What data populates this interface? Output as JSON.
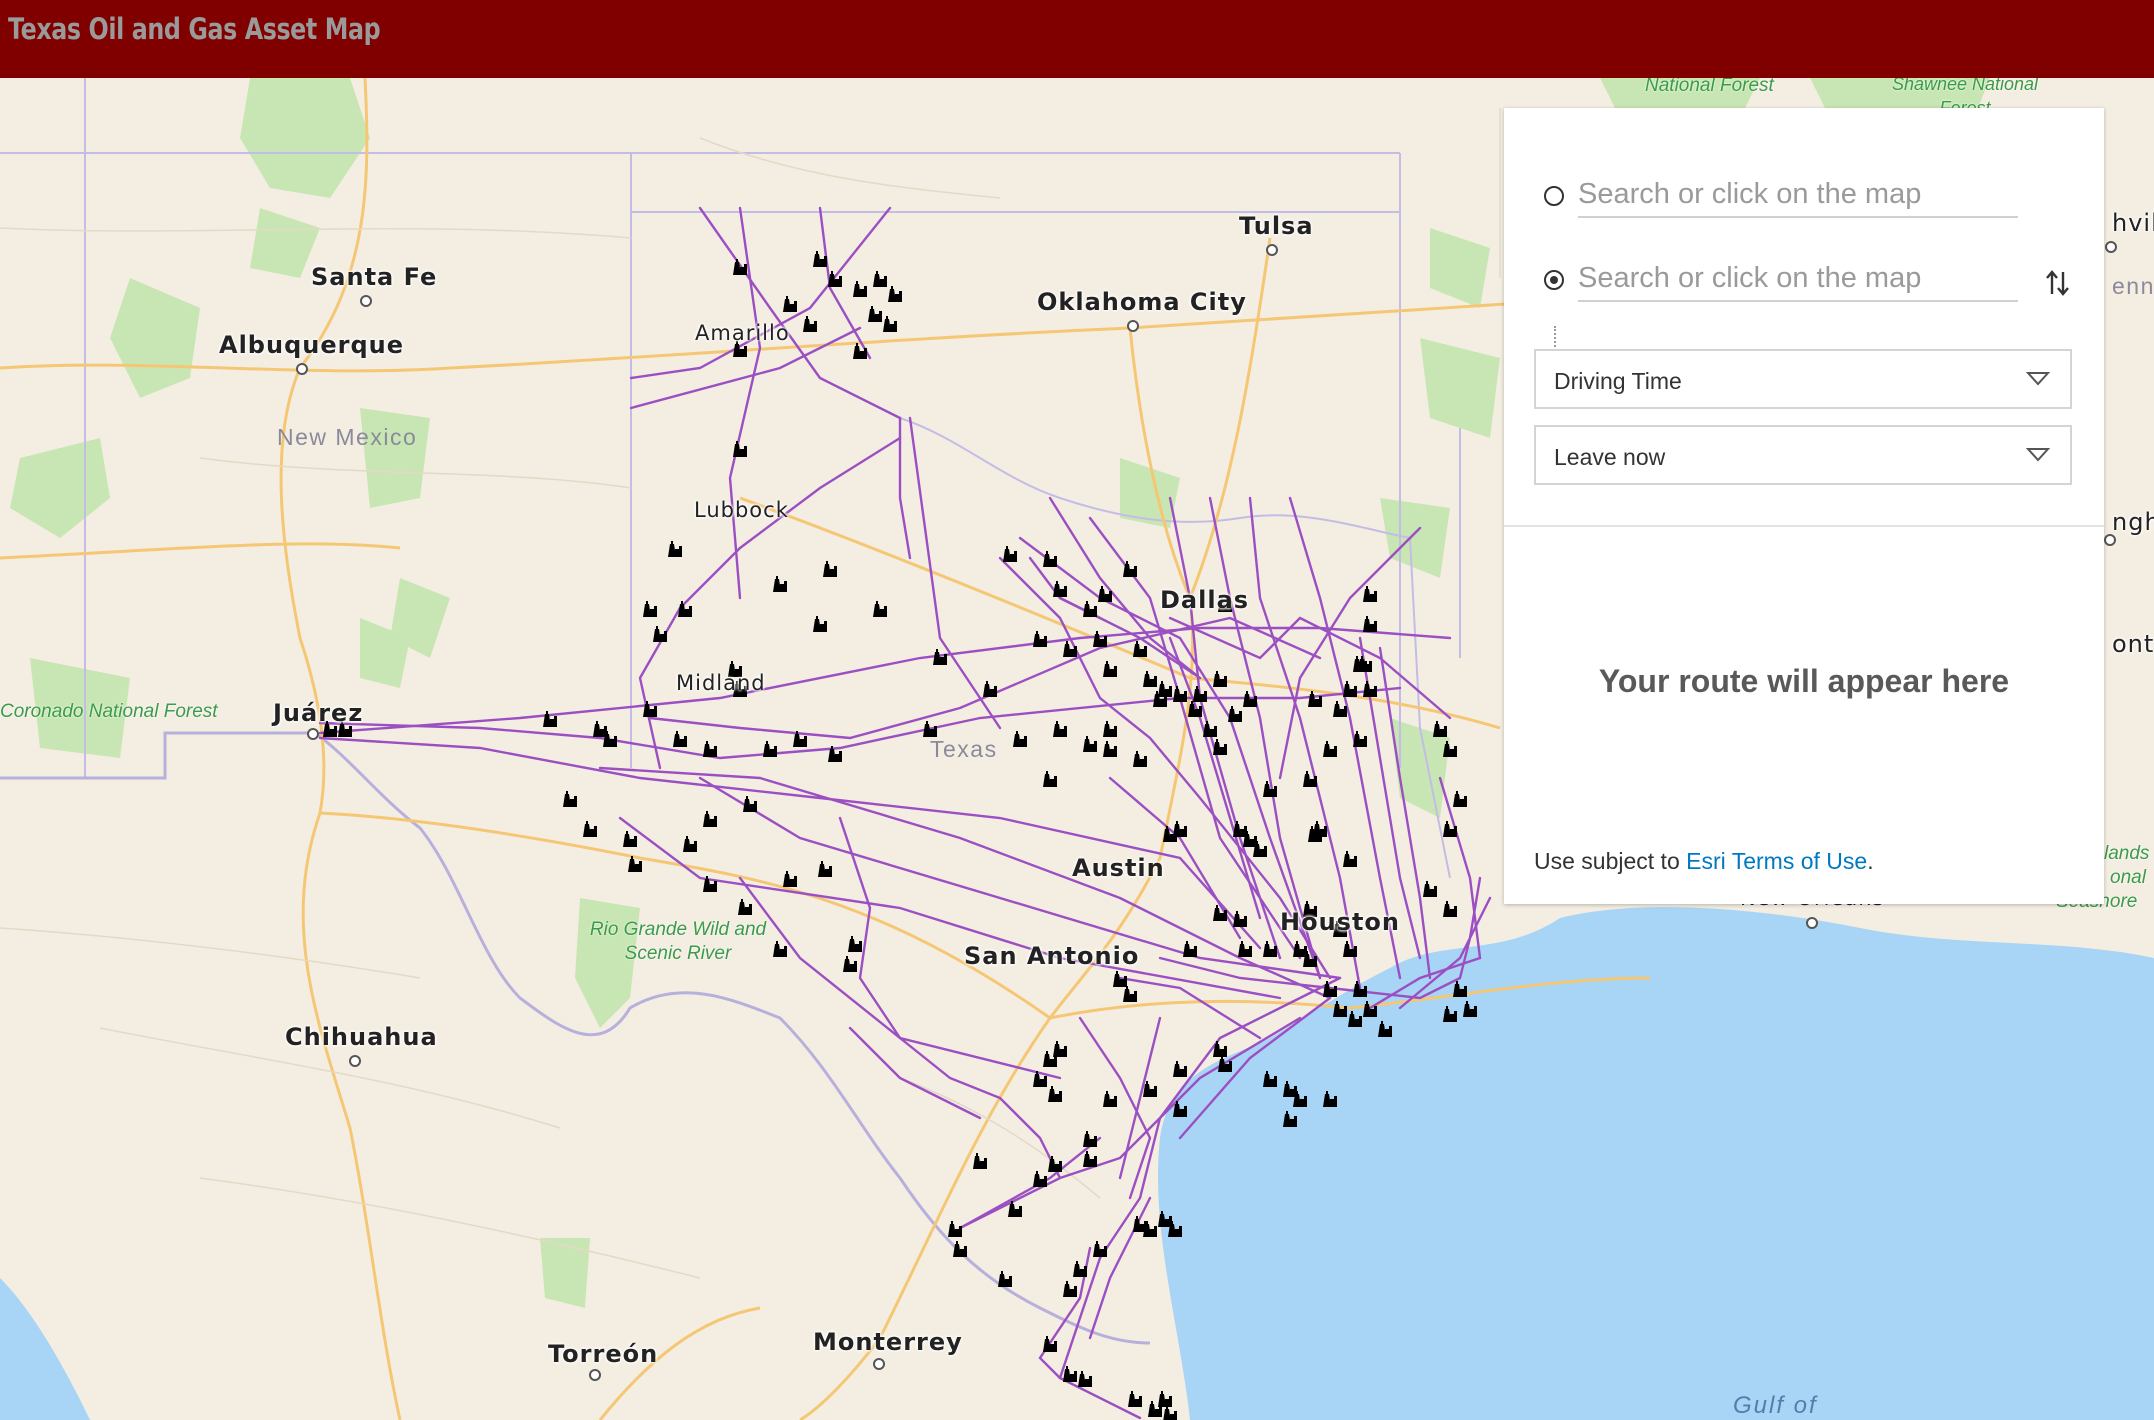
{
  "app": {
    "title": "Texas Oil and Gas Asset Map"
  },
  "map": {
    "cities": [
      "Santa Fe",
      "Albuquerque",
      "Amarillo",
      "Tulsa",
      "Oklahoma City",
      "Lubbock",
      "Dallas",
      "Midland",
      "Juárez",
      "Austin",
      "San Antonio",
      "Houston",
      "Chihuahua",
      "Torreón",
      "Monterrey",
      "New Orleans"
    ],
    "state_labels": [
      "New Mexico",
      "Texas"
    ],
    "park_labels": [
      "Coronado National Forest",
      "Rio Grande Wild and Scenic River",
      "National Forest",
      "Shawnee National Forest"
    ],
    "water_labels": [
      "Gulf of"
    ],
    "edge_labels": [
      "hvil",
      "enne",
      "ngha",
      "ontg",
      "lands",
      "onal",
      "Seashore"
    ],
    "layers": {
      "pipelines": {
        "color": "#9b4fc2"
      },
      "facilities": {
        "icon": "refinery-icon",
        "color": "#000000"
      }
    }
  },
  "directions": {
    "origin": {
      "placeholder": "Search or click on the map",
      "value": ""
    },
    "destination": {
      "placeholder": "Search or click on the map",
      "value": ""
    },
    "swap_icon": "swap-arrows-icon",
    "travel_mode": "Driving Time",
    "departure": "Leave now",
    "route_placeholder": "Your route will appear here",
    "terms_prefix": "Use subject to ",
    "terms_link": "Esri Terms of Use",
    "terms_suffix": "."
  }
}
